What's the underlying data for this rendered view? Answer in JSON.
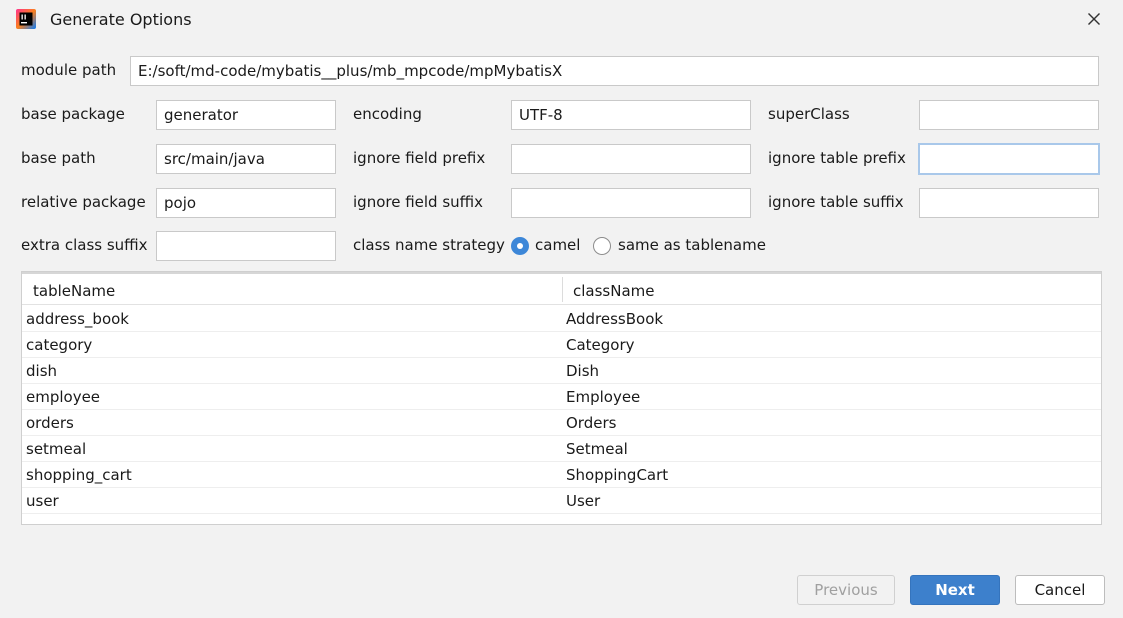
{
  "window": {
    "title": "Generate Options"
  },
  "form": {
    "module_path": {
      "label": "module path",
      "value": "E:/soft/md-code/mybatis__plus/mb_mpcode/mpMybatisX"
    },
    "base_package": {
      "label": "base package",
      "value": "generator"
    },
    "encoding": {
      "label": "encoding",
      "value": "UTF-8"
    },
    "super_class": {
      "label": "superClass",
      "value": ""
    },
    "base_path": {
      "label": "base path",
      "value": "src/main/java"
    },
    "ignore_field_prefix": {
      "label": "ignore field prefix",
      "value": ""
    },
    "ignore_table_prefix": {
      "label": "ignore table prefix",
      "value": ""
    },
    "relative_package": {
      "label": "relative package",
      "value": "pojo"
    },
    "ignore_field_suffix": {
      "label": "ignore field suffix",
      "value": ""
    },
    "ignore_table_suffix": {
      "label": "ignore table suffix",
      "value": ""
    },
    "extra_class_suffix": {
      "label": "extra class suffix",
      "value": ""
    },
    "class_name_strategy": {
      "label": "class name strategy",
      "options": [
        "camel",
        "same as tablename"
      ],
      "selected": "camel"
    }
  },
  "table": {
    "columns": [
      "tableName",
      "className"
    ],
    "rows": [
      [
        "address_book",
        "AddressBook"
      ],
      [
        "category",
        "Category"
      ],
      [
        "dish",
        "Dish"
      ],
      [
        "employee",
        "Employee"
      ],
      [
        "orders",
        "Orders"
      ],
      [
        "setmeal",
        "Setmeal"
      ],
      [
        "shopping_cart",
        "ShoppingCart"
      ],
      [
        "user",
        "User"
      ]
    ]
  },
  "buttons": {
    "previous": "Previous",
    "next": "Next",
    "cancel": "Cancel"
  },
  "colors": {
    "accent": "#3d80cc",
    "dialog_bg": "#f2f2f2",
    "focus_border": "#a9c8ea"
  },
  "icons": {
    "app": "intellij-idea-icon",
    "close": "close-icon"
  }
}
